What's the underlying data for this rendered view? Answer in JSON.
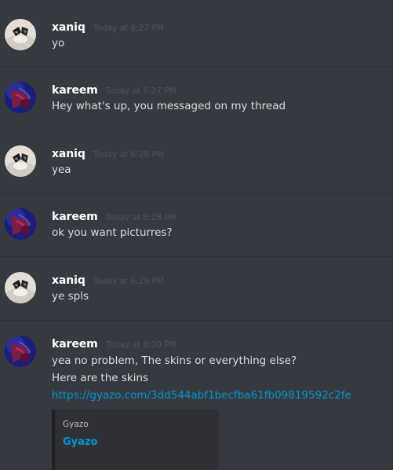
{
  "messages": [
    {
      "author": "xaniq",
      "timestamp": "Today at 6:27 PM",
      "avatar": "xaniq-avatar",
      "lines": [
        "yo"
      ]
    },
    {
      "author": "kareem",
      "timestamp": "Today at 6:27 PM",
      "avatar": "kareem-avatar",
      "lines": [
        "Hey what's up, you messaged on my thread"
      ]
    },
    {
      "author": "xaniq",
      "timestamp": "Today at 6:28 PM",
      "avatar": "xaniq-avatar",
      "lines": [
        "yea"
      ]
    },
    {
      "author": "kareem",
      "timestamp": "Today at 6:28 PM",
      "avatar": "kareem-avatar",
      "lines": [
        "ok you want picturres?"
      ]
    },
    {
      "author": "xaniq",
      "timestamp": "Today at 6:29 PM",
      "avatar": "xaniq-avatar",
      "lines": [
        "ye spls"
      ]
    },
    {
      "author": "kareem",
      "timestamp": "Today at 6:30 PM",
      "avatar": "kareem-avatar",
      "lines": [
        "yea no problem, The skins or everything else?",
        "Here are the skins"
      ],
      "link": "https://gyazo.com/3dd544abf1becfba61fb09819592c2fe",
      "embed": {
        "provider": "Gyazo",
        "title": "Gyazo"
      }
    }
  ],
  "colors": {
    "background": "#36393f",
    "author": "#ffffff",
    "timestamp": "#4f5359",
    "text": "#dcddde",
    "link": "#0096cf",
    "embed_bg": "#2f3136"
  }
}
